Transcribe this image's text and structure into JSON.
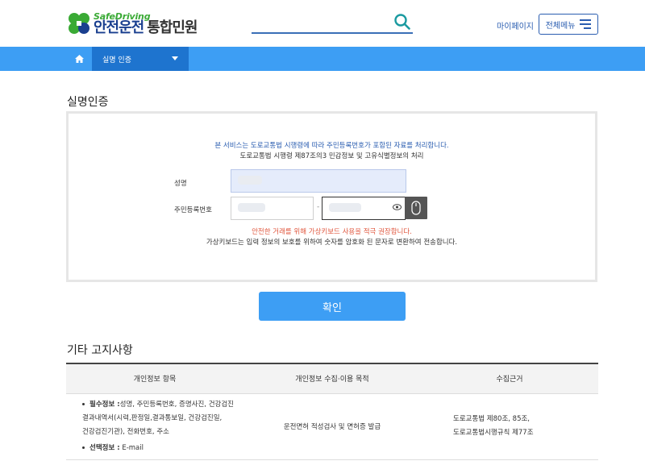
{
  "header": {
    "logo_en": "SafeDriving",
    "logo_ko": "안전운전",
    "logo_sub": "통합민원",
    "search_placeholder": "",
    "mypage_label": "마이페이지",
    "allmenu_label": "전체메뉴"
  },
  "nav": {
    "crumb_label": "실명 인증"
  },
  "auth": {
    "title": "실명인증",
    "notice_line1": "본 서비스는 도로교통법 시행령에 따라 주민등록번호가 포함된 자료를 처리합니다.",
    "notice_line2": "도로교통법 시행령 제87조의3 민감정보 및 고유식별정보의 처리",
    "name_label": "성명",
    "rrn_label": "주민등록번호",
    "rrn_separator": "-",
    "warning": "안전한 거래를 위해 가상키보드 사용을 적극 권장합니다.",
    "description": "가상키보드는 입력 정보의 보호를 위하여 숫자를 암호화 된 문자로 변환하여 전송합니다.",
    "confirm_label": "확인"
  },
  "notices": {
    "title": "기타 고지사항",
    "columns": [
      "개인정보 항목",
      "개인정보 수집·이용 목적",
      "수집근거"
    ],
    "row": {
      "required_label": "필수정보 :",
      "required_lines": [
        "성명, 주민등록번호, 증명사진, 건강검진",
        "결과내역서(시력,판정일,결과통보일, 건강검진일,",
        "건강검진기관), 전화번호, 주소"
      ],
      "optional_label": "선택정보 :",
      "optional_value": "E-mail",
      "purpose": "운전면허 적성검사 및 면허증 발급",
      "basis_lines": [
        "도로교통법 제80조, 85조,",
        "도로교통법시행규칙 제77조"
      ]
    }
  },
  "colors": {
    "nav_blue": "#3d9ef4",
    "crumb_blue": "#1e74cf",
    "brand_green": "#3aaa35",
    "brand_navy": "#1a3f8f",
    "warning_red": "#e0563d"
  }
}
